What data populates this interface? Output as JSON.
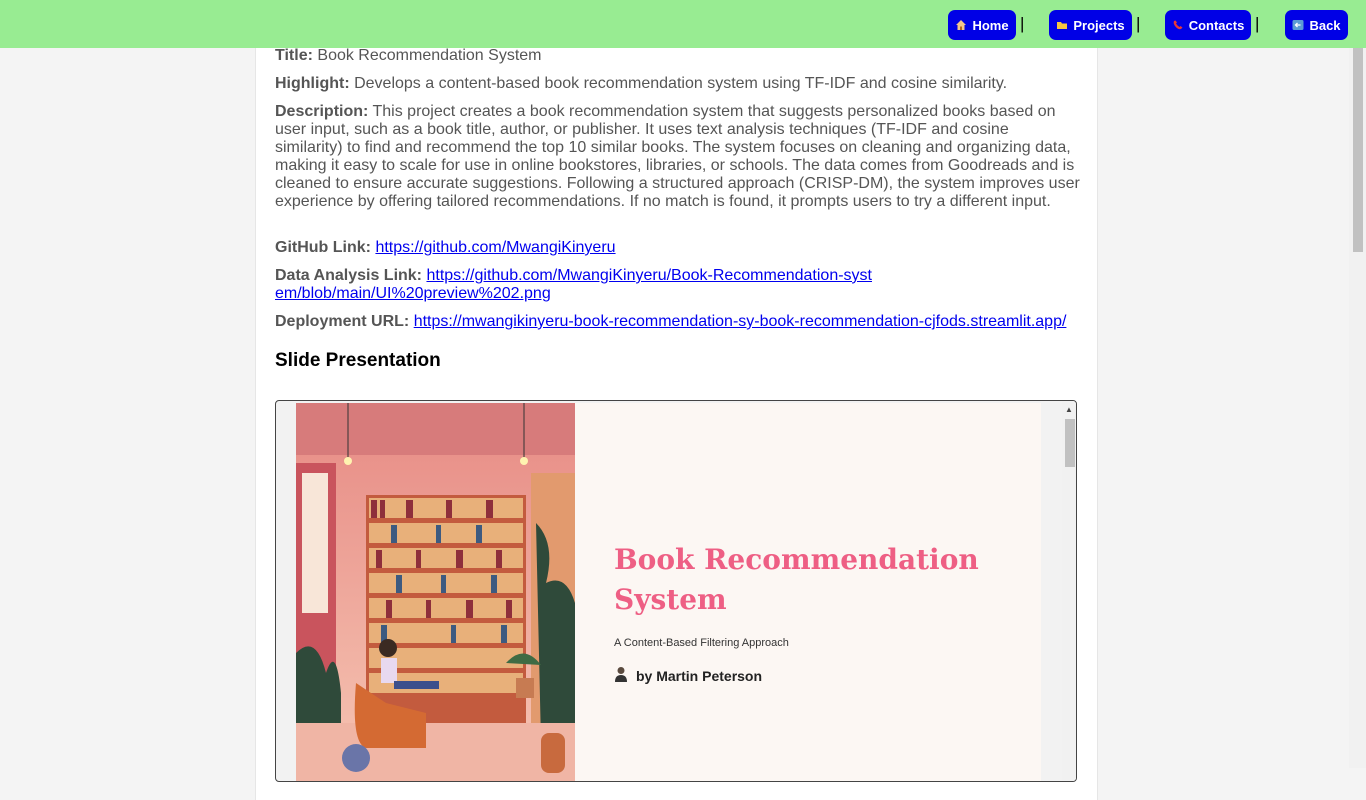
{
  "nav": {
    "home_label": "Home",
    "projects_label": "Projects",
    "contacts_label": "Contacts",
    "back_label": "Back",
    "separator": "|"
  },
  "project": {
    "title_label": "Title:",
    "title_value": "Book Recommendation System",
    "highlight_label": "Highlight:",
    "highlight_value": "Develops a content-based book recommendation system using TF-IDF and cosine similarity.",
    "description_label": "Description:",
    "description_value": "This project creates a book recommendation system that suggests personalized books based on user input, such as a book title, author, or publisher. It uses text analysis techniques (TF-IDF and cosine similarity) to find and recommend the top 10 similar books. The system focuses on cleaning and organizing data, making it easy to scale for use in online bookstores, libraries, or schools. The data comes from Goodreads and is cleaned to ensure accurate suggestions. Following a structured approach (CRISP-DM), the system improves user experience by offering tailored recommendations. If no match is found, it prompts users to try a different input.",
    "github_label": "GitHub Link:",
    "github_url": "https://github.com/MwangiKinyeru",
    "analysis_label": "Data Analysis Link:",
    "analysis_url": "https://github.com/MwangiKinyeru/Book-Recommendation-system/blob/main/UI%20preview%202.png",
    "deploy_label": "Deployment URL:",
    "deploy_url": "https://mwangikinyeru-book-recommendation-sy-book-recommendation-cjfods.streamlit.app/"
  },
  "slides": {
    "heading": "Slide Presentation",
    "slide_title": "Book Recommendation System",
    "slide_subtitle": "A Content-Based Filtering Approach",
    "slide_author": "by Martin Peterson"
  },
  "colors": {
    "navbar": "#98ec92",
    "nav_button": "#0000e6",
    "slide_title": "#ee5f84",
    "link": "#0000ee"
  }
}
